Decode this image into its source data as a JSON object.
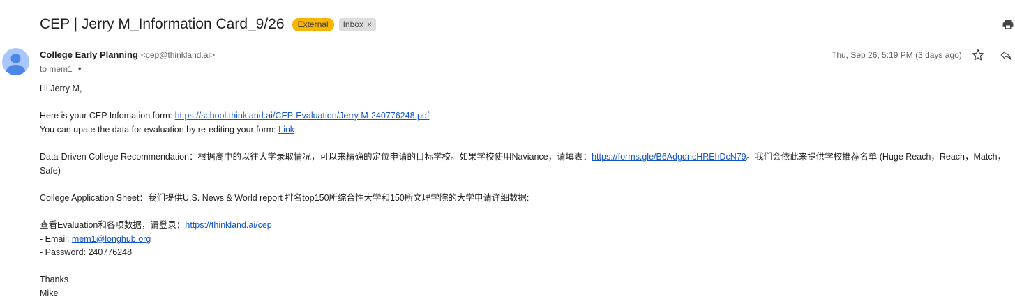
{
  "email": {
    "subject": "CEP | Jerry M_Information Card_9/26",
    "labels": {
      "external": "External",
      "inbox": "Inbox",
      "inbox_remove": "×"
    },
    "sender": {
      "name": "College Early Planning",
      "email": "<cep@thinkland.ai>"
    },
    "to": "to mem1",
    "date": "Thu, Sep 26, 5:19 PM (3 days ago)"
  },
  "body": {
    "greeting": "Hi Jerry M,",
    "line1_prefix": "Here is your CEP Infomation form: ",
    "line1_link": "https://school.thinkland.ai/CEP-Evaluation/Jerry M-240776248.pdf",
    "line2_prefix": "You can upate the data for evaluation by re-editing your form: ",
    "line2_link": "Link",
    "ddcr_prefix": "Data-Driven College Recommendation：根据高中的以往大学录取情况，可以来精确的定位申请的目标学校。如果学校使用Naviance，请填表：",
    "ddcr_link": "https://forms.gle/B6AdgdncHREhDcN79",
    "ddcr_suffix": "。我们会依此来提供学校推荐名单 (Huge Reach，Reach，Match，Safe)",
    "cas_text": "College Application Sheet：我们提供U.S. News & World report 排名top150所综合性大学和150所文理学院的大学申请详细数据:",
    "login_prefix": "查看Evaluation和各项数据，请登录：",
    "login_link": "https://thinkland.ai/cep",
    "email_prefix": "- Email: ",
    "email_link": "mem1@longhub.org",
    "password_line": "- Password: 240776248",
    "thanks": "Thanks",
    "signature": "Mike"
  },
  "colors": {
    "link": "#1155cc",
    "external_tag": "#f6b500",
    "avatar_bg": "#a8c7fa",
    "avatar_fg": "#4e86e8"
  },
  "icons": [
    "print-icon",
    "avatar-icon",
    "chevron-down-icon",
    "star-icon",
    "reply-icon"
  ]
}
